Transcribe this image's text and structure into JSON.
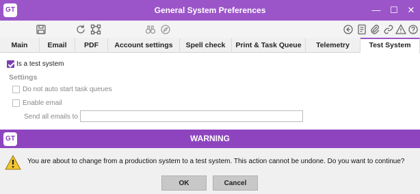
{
  "window": {
    "logo": "GT",
    "title": "General System Preferences",
    "controls": {
      "minimize": "—",
      "maximize": "☐",
      "close": "✕"
    }
  },
  "toolbar": {
    "icons": [
      "save-icon",
      "refresh-icon",
      "network-icon",
      "binoculars-icon",
      "compass-icon",
      "back-icon",
      "document-icon",
      "attachment-icon",
      "link-icon",
      "alert-icon",
      "help-icon"
    ]
  },
  "tabs": [
    "Main",
    "Email",
    "PDF",
    "Account settings",
    "Spell check",
    "Print & Task Queue",
    "Telemetry",
    "Test System"
  ],
  "active_tab": "Test System",
  "test_system": {
    "is_test_label": "Is a test system",
    "is_test_checked": true,
    "settings_heading": "Settings",
    "no_autostart_label": "Do not auto start task queues",
    "enable_email_label": "Enable email",
    "send_all_label": "Send all emails to",
    "send_all_value": ""
  },
  "dialog": {
    "logo": "GT",
    "title": "WARNING",
    "message": "You are about to change from a production system to a test system. This action cannot be undone. Do you want to continue?",
    "ok_label": "OK",
    "cancel_label": "Cancel"
  },
  "colors": {
    "accent": "#9b55c8",
    "dialog_accent": "#8e44bf",
    "checkbox": "#7b3fb0"
  }
}
